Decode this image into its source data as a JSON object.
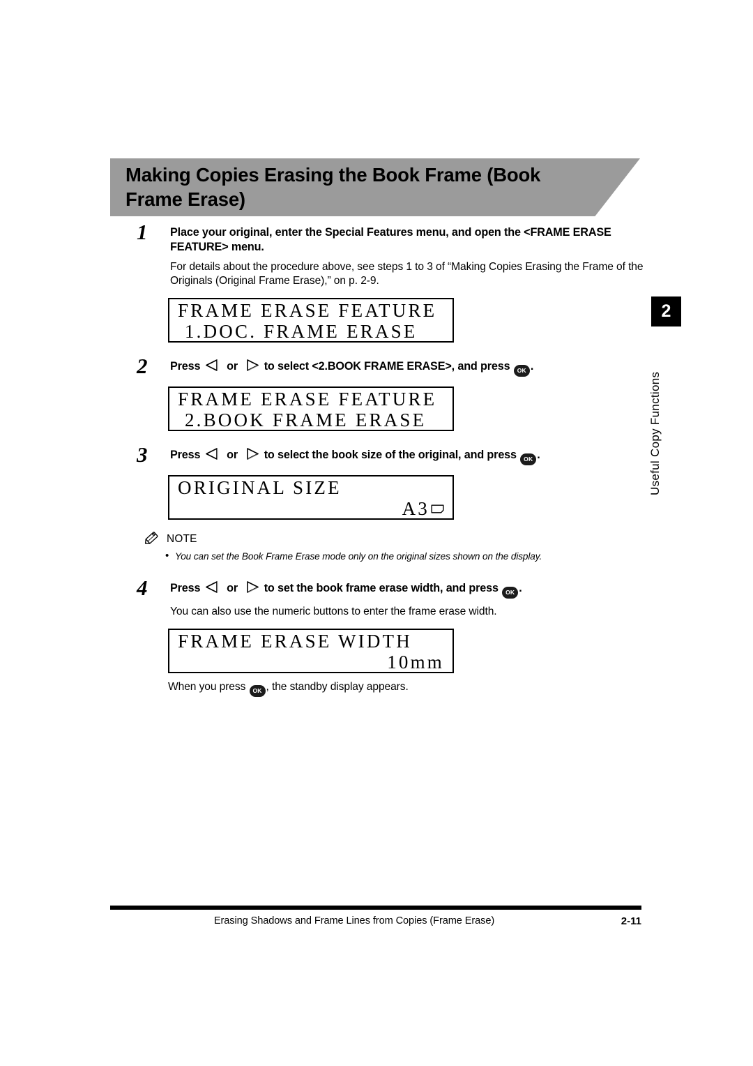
{
  "section": {
    "title": "Making Copies Erasing the Book Frame (Book Frame Erase)",
    "banner_color": "#9b9b9b"
  },
  "chapter_tab": {
    "number": "2",
    "label": "Useful Copy Functions",
    "color": "#000000"
  },
  "icons": {
    "left_arrow": "arrow-left-icon",
    "right_arrow": "arrow-right-icon",
    "ok_button": "ok-button-icon",
    "ok_label": "OK",
    "pencil": "pencil-note-icon",
    "paper_landscape": "paper-landscape-icon"
  },
  "steps": [
    {
      "number": "1",
      "heading_a": "Place your original, enter the Special Features menu, and open the <FRAME ERASE",
      "heading_b": "FEATURE> menu.",
      "sub": "For details about the procedure above, see steps 1 to 3 of “Making Copies Erasing the Frame of the Originals (Original Frame Erase),” on p. 2-9."
    },
    {
      "number": "2",
      "head_pre": "Press",
      "head_mid": "or",
      "head_post": "to select <2.BOOK FRAME ERASE>, and press",
      "head_end": "."
    },
    {
      "number": "3",
      "head_pre": "Press",
      "head_mid": "or",
      "head_post": "to select the book size of the original, and press",
      "head_end": "."
    },
    {
      "number": "4",
      "head_pre": "Press",
      "head_mid": "or",
      "head_post": "to set the book frame erase width, and press",
      "head_end": ".",
      "sub": "You can also use the numeric buttons to enter the frame erase width."
    }
  ],
  "displays": {
    "display1": {
      "line1": "FRAME ERASE FEATURE",
      "line2": " 1.DOC. FRAME ERASE"
    },
    "display2": {
      "line1": "FRAME ERASE FEATURE",
      "line2": " 2.BOOK FRAME ERASE"
    },
    "display3": {
      "line1": "ORIGINAL SIZE",
      "line2": "A3"
    },
    "display4": {
      "line1": "FRAME ERASE WIDTH",
      "line2": "10mm"
    }
  },
  "note": {
    "label": "NOTE",
    "bullet": "•",
    "item": "You can set the Book Frame Erase mode only on the original sizes shown on the display."
  },
  "trailing": {
    "pre": "When you press",
    "post": ", the standby display appears."
  },
  "footer": {
    "title": "Erasing Shadows and Frame Lines from Copies (Frame Erase)",
    "page": "2-11"
  }
}
